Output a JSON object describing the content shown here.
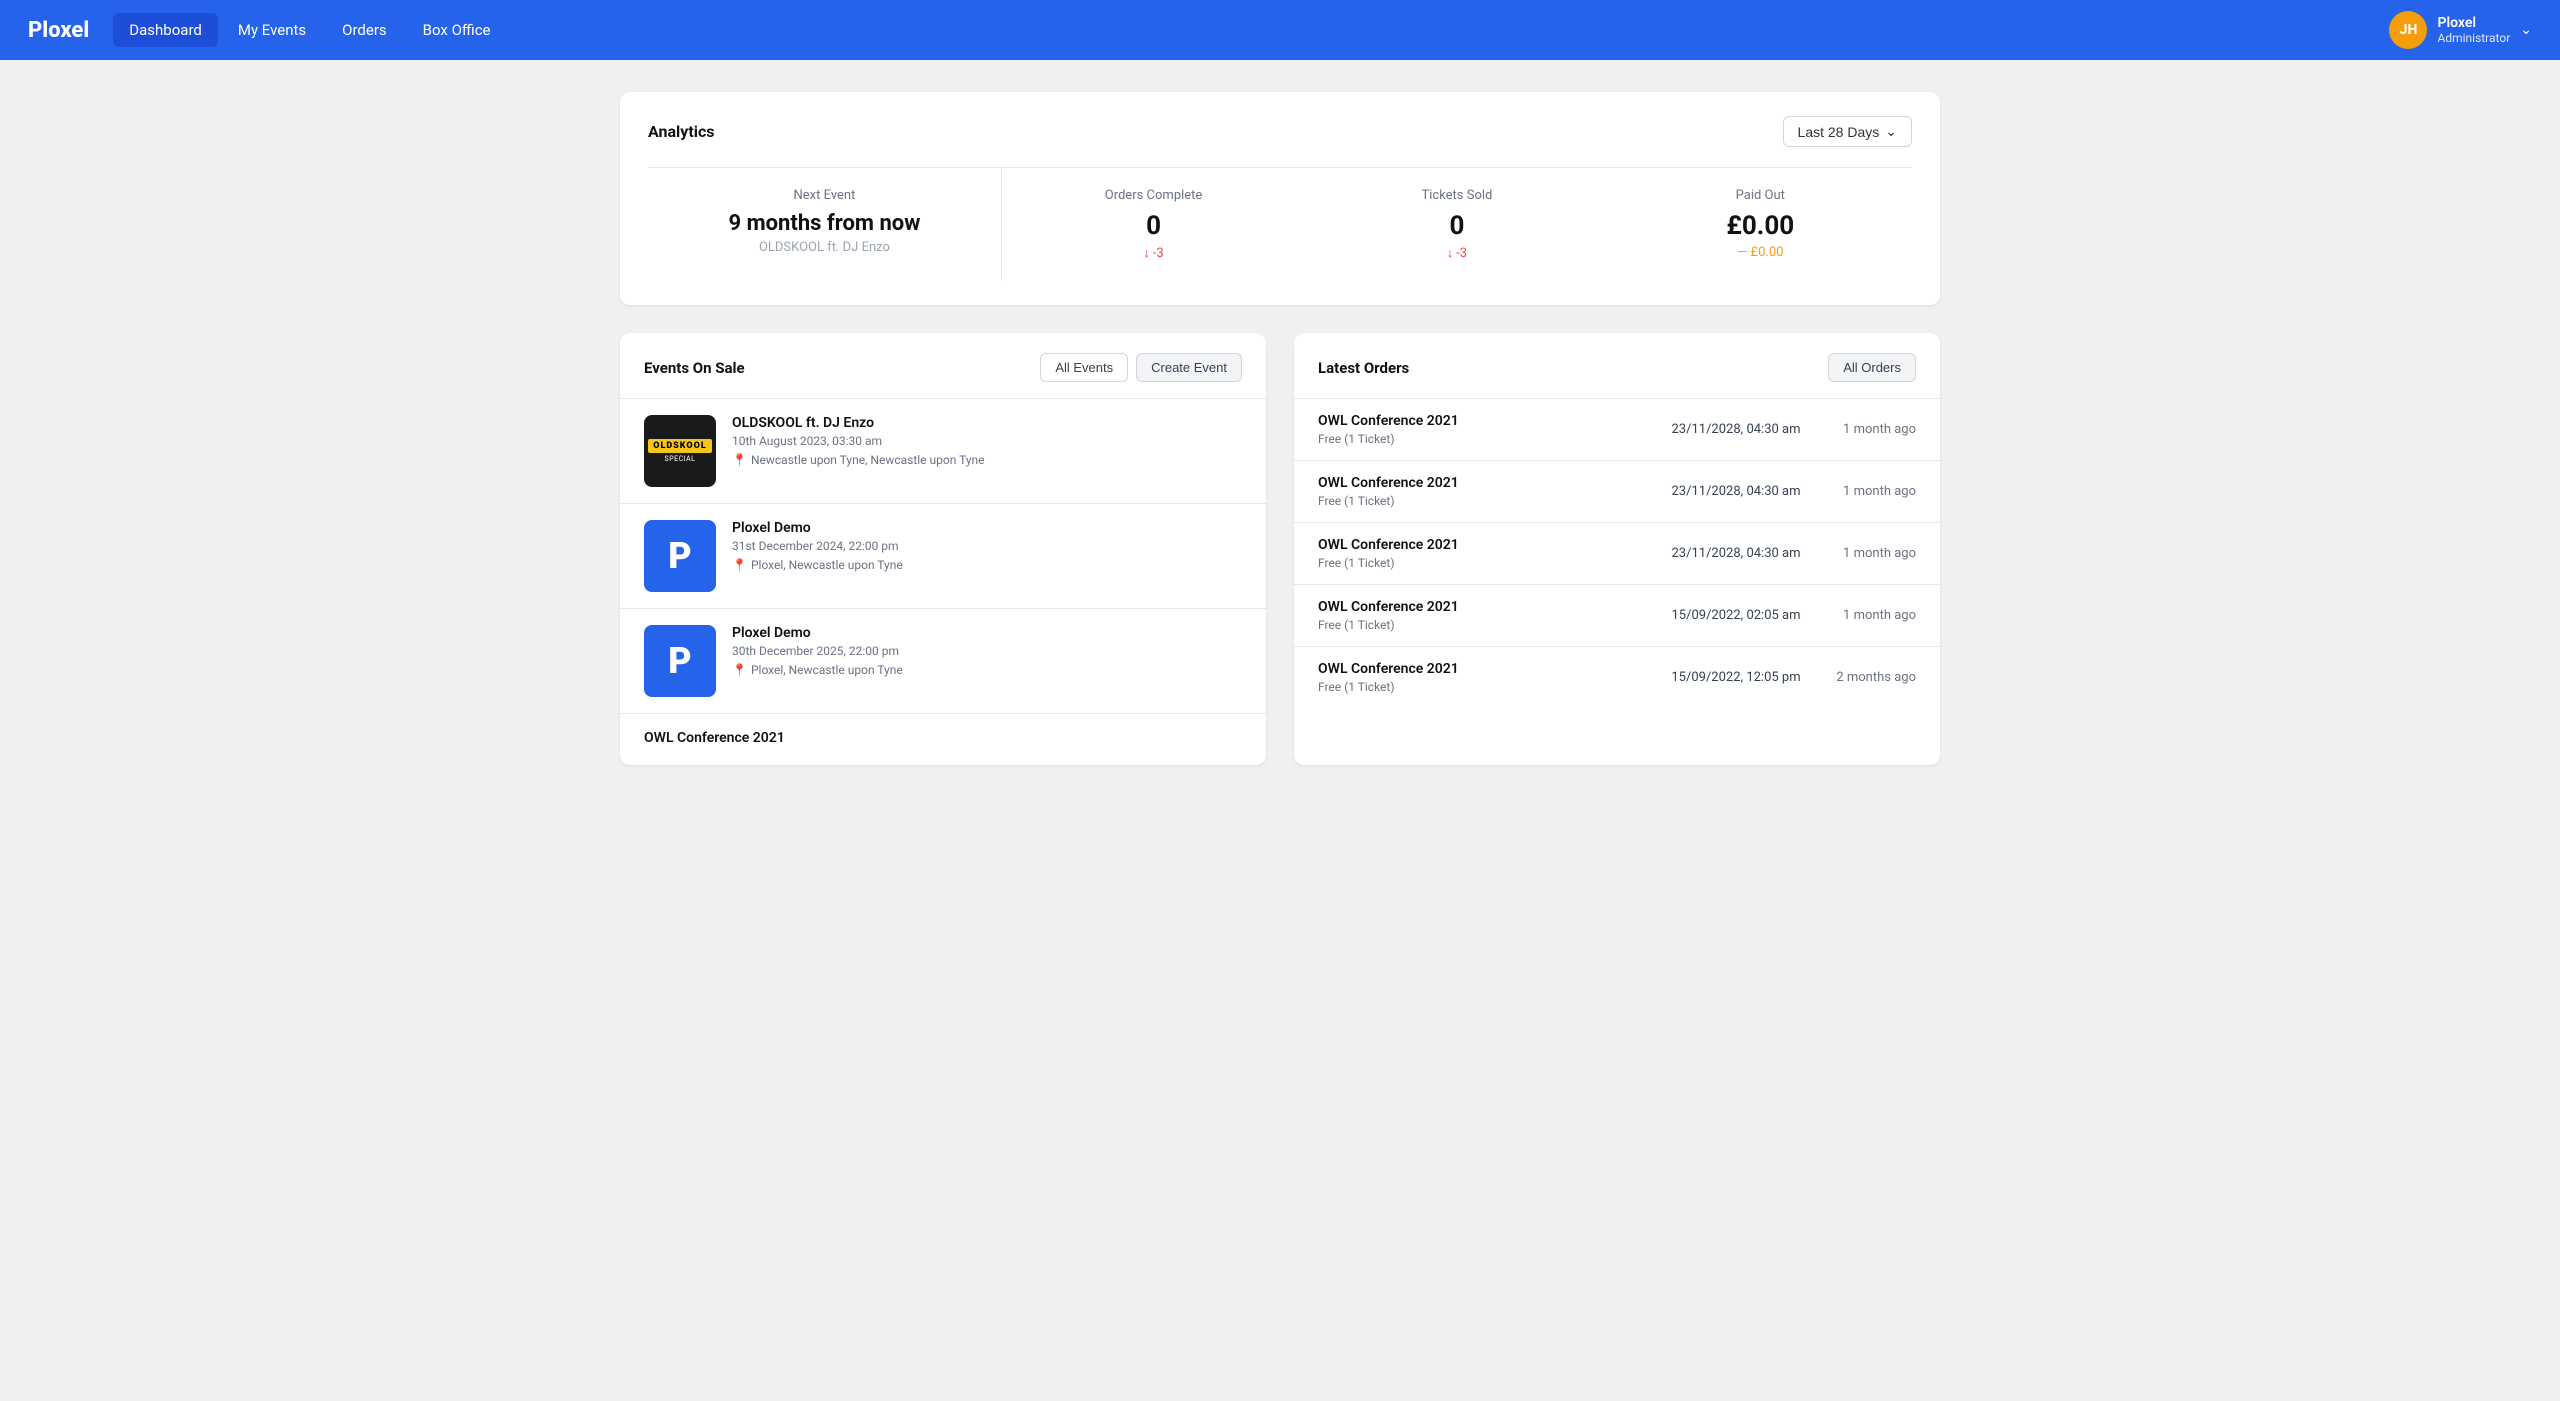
{
  "app": {
    "logo": "Ploxel"
  },
  "nav": {
    "items": [
      {
        "label": "Dashboard",
        "active": true
      },
      {
        "label": "My Events",
        "active": false
      },
      {
        "label": "Orders",
        "active": false
      },
      {
        "label": "Box Office",
        "active": false
      }
    ],
    "user": {
      "initials": "JH",
      "name": "Ploxel",
      "role": "Administrator"
    }
  },
  "analytics": {
    "title": "Analytics",
    "date_filter": "Last 28 Days",
    "stats": {
      "next_event": {
        "label": "Next Event",
        "value": "9 months from now",
        "sub": "OLDSKOOL ft. DJ Enzo"
      },
      "orders_complete": {
        "label": "Orders Complete",
        "value": "0",
        "delta": "-3",
        "delta_type": "negative"
      },
      "tickets_sold": {
        "label": "Tickets Sold",
        "value": "0",
        "delta": "-3",
        "delta_type": "negative"
      },
      "paid_out": {
        "label": "Paid Out",
        "value": "£0.00",
        "delta": "— £0.00",
        "delta_type": "neutral"
      }
    }
  },
  "events_panel": {
    "title": "Events On Sale",
    "all_events_label": "All Events",
    "create_event_label": "Create Event",
    "events": [
      {
        "name": "OLDSKOOL ft. DJ Enzo",
        "date": "10th August 2023, 03:30 am",
        "location": "Newcastle upon Tyne, Newcastle upon Tyne",
        "thumb_type": "dark",
        "thumb_label": "OLDSKOOL",
        "thumb_sub": "SPECIAL"
      },
      {
        "name": "Ploxel Demo",
        "date": "31st December 2024, 22:00 pm",
        "location": "Ploxel, Newcastle upon Tyne",
        "thumb_type": "blue",
        "thumb_label": "P"
      },
      {
        "name": "Ploxel Demo",
        "date": "30th December 2025, 22:00 pm",
        "location": "Ploxel, Newcastle upon Tyne",
        "thumb_type": "blue",
        "thumb_label": "P"
      },
      {
        "name": "OWL Conference 2021",
        "date": "",
        "location": "",
        "thumb_type": "none",
        "thumb_label": ""
      }
    ]
  },
  "orders_panel": {
    "title": "Latest Orders",
    "all_orders_label": "All Orders",
    "orders": [
      {
        "event_name": "OWL Conference 2021",
        "date": "23/11/2028, 04:30 am",
        "ticket_type": "Free (1 Ticket)",
        "time_ago": "1 month ago"
      },
      {
        "event_name": "OWL Conference 2021",
        "date": "23/11/2028, 04:30 am",
        "ticket_type": "Free (1 Ticket)",
        "time_ago": "1 month ago"
      },
      {
        "event_name": "OWL Conference 2021",
        "date": "23/11/2028, 04:30 am",
        "ticket_type": "Free (1 Ticket)",
        "time_ago": "1 month ago"
      },
      {
        "event_name": "OWL Conference 2021",
        "date": "15/09/2022, 02:05 am",
        "ticket_type": "Free (1 Ticket)",
        "time_ago": "1 month ago"
      },
      {
        "event_name": "OWL Conference 2021",
        "date": "15/09/2022, 12:05 pm",
        "ticket_type": "Free (1 Ticket)",
        "time_ago": "2 months ago"
      }
    ]
  }
}
